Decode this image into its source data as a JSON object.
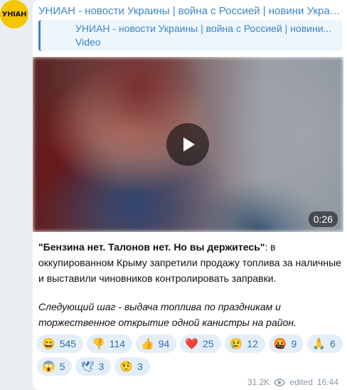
{
  "avatar": {
    "label": "УНІАН",
    "color": "#f6c700"
  },
  "channel_title": "УНИАН - новости Украины | война с Россией | новини Украї...",
  "reply": {
    "title": "УНИАН - новости Украины | война с Россией | новини...",
    "subtitle": "Video"
  },
  "video": {
    "duration": "0:26"
  },
  "message": {
    "bold": "\"Бензина нет. Талонов нет. Но вы держитесь\"",
    "body": ": в оккупированном Крыму запретили продажу топлива за наличные и выставили чиновников контролировать заправки.",
    "italic": "Следующий шаг - выдача топлива по праздникам и торжественное открытие одной канистры на район."
  },
  "reactions": [
    {
      "emoji": "😄",
      "count": "545",
      "icon": "laughing-face-icon"
    },
    {
      "emoji": "👎",
      "count": "114",
      "icon": "thumbs-down-icon"
    },
    {
      "emoji": "👍",
      "count": "94",
      "icon": "thumbs-up-icon"
    },
    {
      "emoji": "❤️",
      "count": "25",
      "icon": "heart-icon"
    },
    {
      "emoji": "😢",
      "count": "12",
      "icon": "crying-face-icon"
    },
    {
      "emoji": "🤬",
      "count": "9",
      "icon": "swearing-face-icon"
    },
    {
      "emoji": "🙏",
      "count": "6",
      "icon": "folded-hands-icon"
    },
    {
      "emoji": "😱",
      "count": "5",
      "icon": "screaming-face-icon"
    },
    {
      "emoji": "🕊",
      "count": "3",
      "icon": "dove-icon"
    },
    {
      "emoji": "🤨",
      "count": "3",
      "icon": "raised-eyebrow-face-icon"
    }
  ],
  "meta": {
    "views": "31.2K",
    "edited": "edited",
    "time": "16:44"
  }
}
